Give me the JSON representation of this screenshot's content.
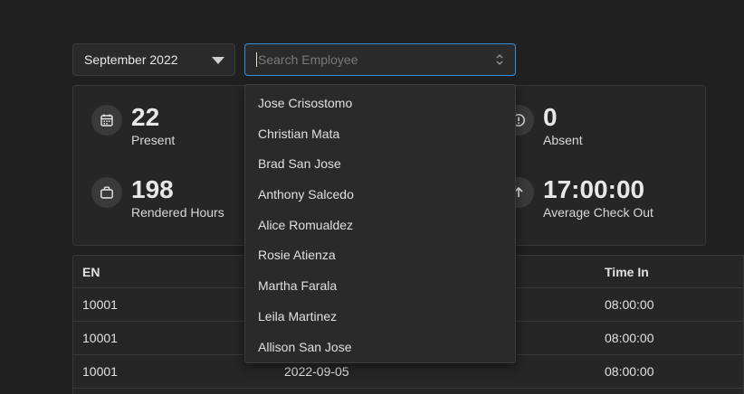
{
  "filters": {
    "month_value": "September 2022",
    "search_placeholder": "Search Employee"
  },
  "stats": {
    "present": {
      "value": "22",
      "label": "Present",
      "icon": "calendar-icon"
    },
    "absent": {
      "value": "0",
      "label": "Absent",
      "icon": "alert-circle-icon"
    },
    "rendered_hours": {
      "value": "198",
      "label": "Rendered Hours",
      "icon": "briefcase-icon"
    },
    "avg_check_out": {
      "value": "17:00:00",
      "label": "Average Check Out",
      "icon": "arrow-up-icon"
    }
  },
  "table": {
    "headers": {
      "en": "EN",
      "time_in": "Time In"
    },
    "rows": [
      {
        "en": "10001",
        "date": "",
        "time_in": "08:00:00"
      },
      {
        "en": "10001",
        "date": "",
        "time_in": "08:00:00"
      },
      {
        "en": "10001",
        "date": "2022-09-05",
        "time_in": "08:00:00"
      }
    ]
  },
  "dropdown": {
    "options": [
      "Jose Crisostomo",
      "Christian Mata",
      "Brad San Jose",
      "Anthony Salcedo",
      "Alice Romualdez",
      "Rosie Atienza",
      "Martha Farala",
      "Leila Martinez",
      "Allison San Jose"
    ]
  }
}
